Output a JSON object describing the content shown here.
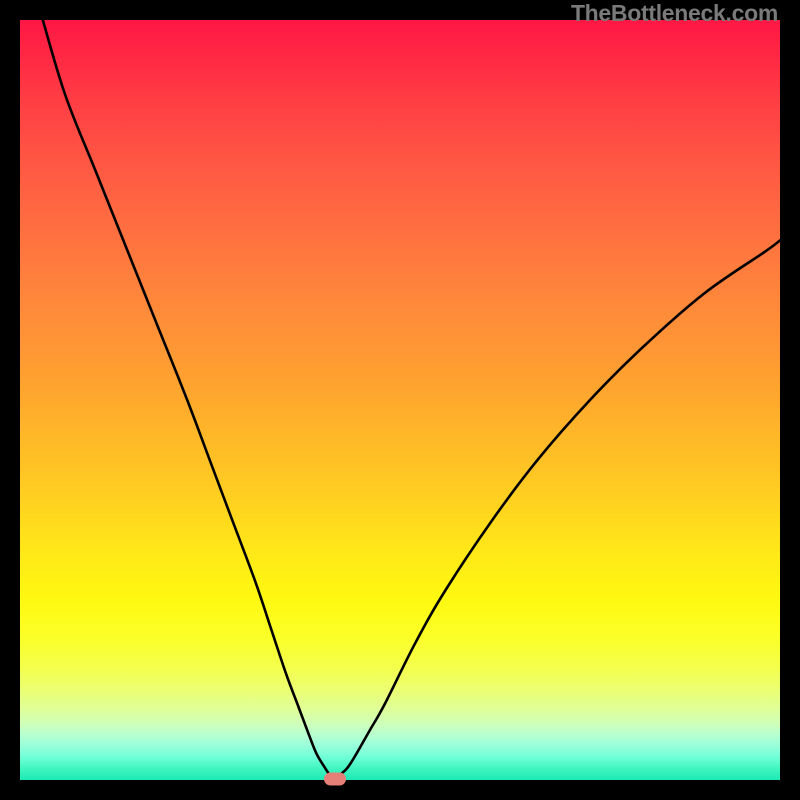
{
  "watermark": "TheBottleneck.com",
  "chart_data": {
    "type": "line",
    "title": "",
    "xlabel": "",
    "ylabel": "",
    "xlim": [
      0,
      100
    ],
    "ylim": [
      0,
      100
    ],
    "grid": false,
    "series": [
      {
        "name": "bottleneck-curve",
        "x": [
          3,
          6,
          10,
          14,
          18,
          22,
          25,
          28,
          31,
          33,
          35,
          36.5,
          38,
          39,
          40,
          40.8,
          41.2,
          41.6,
          42,
          43,
          44,
          46,
          48,
          52,
          56,
          62,
          68,
          75,
          82,
          90,
          98,
          100
        ],
        "y": [
          100,
          90,
          80,
          70,
          60,
          50,
          42,
          34,
          26,
          20,
          14,
          10,
          6,
          3.5,
          1.8,
          0.6,
          0.2,
          0.2,
          0.6,
          1.5,
          3,
          6.5,
          10,
          18,
          25,
          34,
          42,
          50,
          57,
          64,
          69.5,
          71
        ]
      }
    ],
    "marker": {
      "x": 41.5,
      "y": 0.1,
      "color": "#e58078"
    },
    "gradient_stops": [
      {
        "pos": 0,
        "color": "#ff1744"
      },
      {
        "pos": 50,
        "color": "#ffc107"
      },
      {
        "pos": 80,
        "color": "#ffeb3b"
      },
      {
        "pos": 100,
        "color": "#1de9b6"
      }
    ]
  }
}
